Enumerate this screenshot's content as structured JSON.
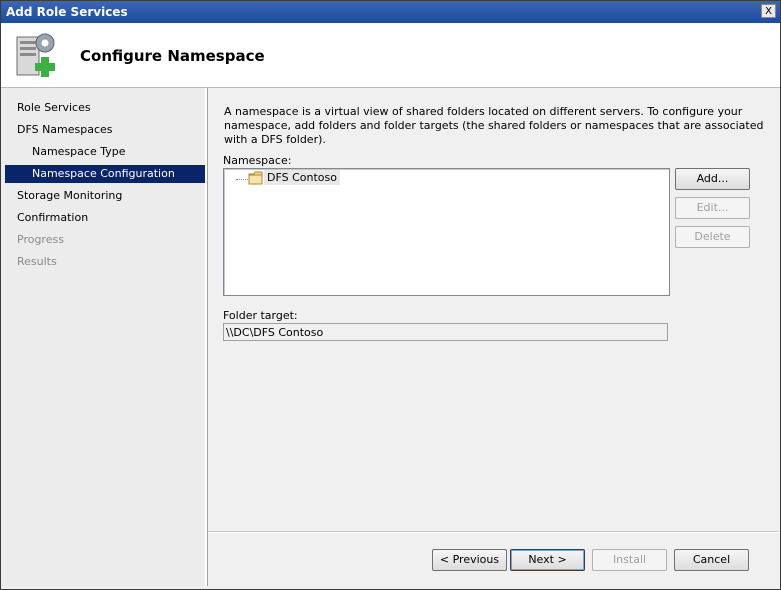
{
  "window": {
    "title": "Add Role Services",
    "close_glyph": "X"
  },
  "header": {
    "title": "Configure Namespace",
    "icon": "server-add-icon"
  },
  "sidebar": {
    "items": [
      {
        "label": "Role Services",
        "state": "normal"
      },
      {
        "label": "DFS Namespaces",
        "state": "normal"
      },
      {
        "label": "Namespace Type",
        "state": "normal"
      },
      {
        "label": "Namespace Configuration",
        "state": "selected"
      },
      {
        "label": "Storage Monitoring",
        "state": "normal"
      },
      {
        "label": "Confirmation",
        "state": "normal"
      },
      {
        "label": "Progress",
        "state": "disabled"
      },
      {
        "label": "Results",
        "state": "disabled"
      }
    ]
  },
  "main": {
    "description": "A namespace is a virtual view of shared folders located on different servers. To configure your namespace, add folders and folder targets (the shared folders or namespaces that are associated with a DFS folder).",
    "namespace_label": "Namespace:",
    "tree_item": "DFS Contoso",
    "add_label": "Add...",
    "edit_label": "Edit...",
    "delete_label": "Delete",
    "folder_target_label": "Folder target:",
    "folder_target_value": "\\\\DC\\DFS Contoso"
  },
  "footer": {
    "previous_label": "< Previous",
    "next_label": "Next >",
    "install_label": "Install",
    "cancel_label": "Cancel"
  },
  "colors": {
    "titlebar": "#1d4a9c",
    "selection": "#0a246a",
    "sidebar": "#ececec"
  }
}
